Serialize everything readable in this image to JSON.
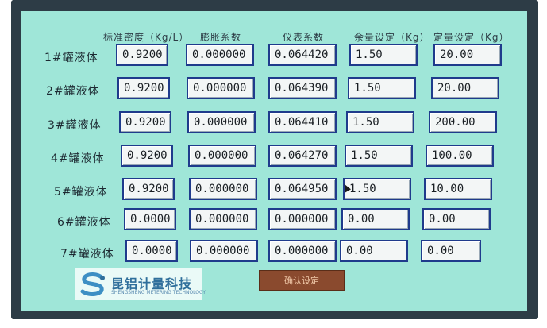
{
  "headers": {
    "density": "标准密度（Kg/L）",
    "expansion": "膨胀系数",
    "meter": "仪表系数",
    "remaining": "余量设定（Kg）",
    "fixed": "定量设定（Kg）"
  },
  "rows": [
    {
      "label": "1#罐液体",
      "density": "0.9200",
      "expansion": "0.000000",
      "meter": "0.064420",
      "remaining": "1.50",
      "fixed": "20.00"
    },
    {
      "label": "2#罐液体",
      "density": "0.9200",
      "expansion": "0.000000",
      "meter": "0.064390",
      "remaining": "1.50",
      "fixed": "20.00"
    },
    {
      "label": "3#罐液体",
      "density": "0.9200",
      "expansion": "0.000000",
      "meter": "0.064410",
      "remaining": "1.50",
      "fixed": "200.00"
    },
    {
      "label": "4#罐液体",
      "density": "0.9200",
      "expansion": "0.000000",
      "meter": "0.064270",
      "remaining": "1.50",
      "fixed": "100.00"
    },
    {
      "label": "5#罐液体",
      "density": "0.9200",
      "expansion": "0.000000",
      "meter": "0.064950",
      "remaining": "1.50",
      "fixed": "10.00"
    },
    {
      "label": "6#罐液体",
      "density": "0.0000",
      "expansion": "0.000000",
      "meter": "0.000000",
      "remaining": "0.00",
      "fixed": "0.00"
    },
    {
      "label": "7#罐液体",
      "density": "0.0000",
      "expansion": "0.000000",
      "meter": "0.000000",
      "remaining": "0.00",
      "fixed": "0.00"
    }
  ],
  "confirm_button": "确认设定",
  "logo": {
    "name_cn": "昆铝计量科技",
    "name_en": "SHENGSHENG METERING TECHNOLOGY"
  },
  "colors": {
    "screen": "#9fe6d8",
    "field_border": "#1f3b8c",
    "button": "#8a4a2e"
  }
}
